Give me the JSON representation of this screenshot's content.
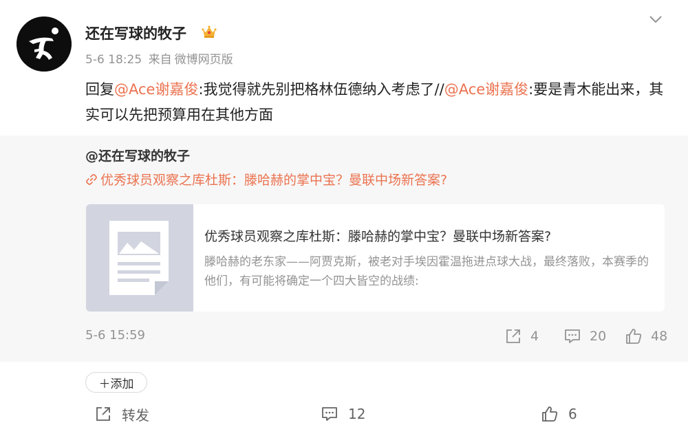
{
  "post": {
    "author": "还在写球的牧子",
    "time": "5-6 18:25",
    "source_prefix": "来自",
    "source": "微博网页版",
    "text_parts": {
      "t1": "回复",
      "m1": "@Ace谢嘉俊",
      "t2": ":我觉得就先别把格林伍德纳入考虑了//",
      "m2": "@Ace谢嘉俊",
      "t3": ":要是青木能出来，其实可以先把预算用在其他方面"
    }
  },
  "repost": {
    "author": "@还在写球的牧子",
    "link_text": "优秀球员观察之库杜斯：滕哈赫的掌中宝？曼联中场新答案?",
    "card": {
      "title": "优秀球员观察之库杜斯：滕哈赫的掌中宝？曼联中场新答案?",
      "desc": "滕哈赫的老东家——阿贾克斯，被老对手埃因霍温拖进点球大战，最终落败，本赛季的他们，有可能将确定一个四大皆空的战绩:"
    },
    "time": "5-6 15:59",
    "repost_count": "4",
    "comment_count": "20",
    "like_count": "48"
  },
  "add_label": "＋添加",
  "actions": {
    "repost_label": "转发",
    "comment_count": "12",
    "like_count": "6"
  },
  "icons": {
    "avatar": "runner-logo-icon",
    "badge": "crown-badge-icon",
    "menu": "chevron-down-icon",
    "link": "link-icon",
    "repost": "share-icon",
    "comment": "comment-icon",
    "like": "thumbs-up-icon"
  },
  "colors": {
    "accent": "#eb7350",
    "muted": "#939393",
    "repost_bg": "#f7f7f7"
  }
}
